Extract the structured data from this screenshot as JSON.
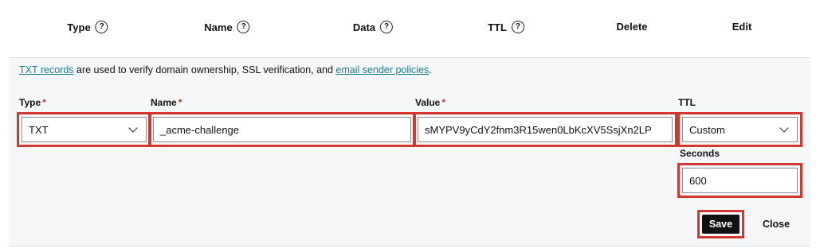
{
  "columns": [
    {
      "label": "Type",
      "help_icon": "?"
    },
    {
      "label": "Name",
      "help_icon": "?"
    },
    {
      "label": "Data",
      "help_icon": "?"
    },
    {
      "label": "TTL",
      "help_icon": "?"
    },
    {
      "label": "Delete"
    },
    {
      "label": "Edit"
    }
  ],
  "info": {
    "link1": "TXT records",
    "text1": " are used to verify domain ownership, SSL verification, and ",
    "link2": "email sender policies",
    "text2": "."
  },
  "form": {
    "type_label": "Type",
    "type_value": "TXT",
    "name_label": "Name",
    "name_value": "_acme-challenge",
    "value_label": "Value",
    "value_value": "sMYPV9yCdY2fnm3R15wen0LbKcXV5SsjXn2LP",
    "ttl_label": "TTL",
    "ttl_value": "Custom",
    "seconds_label": "Seconds",
    "seconds_value": "600",
    "required_marker": "*"
  },
  "actions": {
    "save_label": "Save",
    "close_label": "Close"
  },
  "colors": {
    "accent_link": "#1a7f8a",
    "highlight": "#d1382f",
    "required": "#d6332d",
    "panel_bg": "#f5f7f8"
  }
}
